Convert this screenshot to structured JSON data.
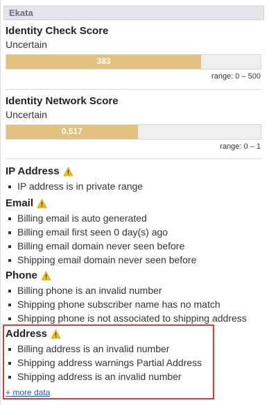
{
  "header": {
    "title": "Ekata"
  },
  "identity_check": {
    "title": "Identity Check Score",
    "status": "Uncertain",
    "value_label": "383",
    "value": 383,
    "range_label": "range: 0 – 500",
    "range_min": 0,
    "range_max": 500
  },
  "identity_network": {
    "title": "Identity Network Score",
    "status": "Uncertain",
    "value_label": "0.517",
    "value": 0.517,
    "range_label": "range: 0 – 1",
    "range_min": 0,
    "range_max": 1
  },
  "ip_address": {
    "title": "IP Address",
    "icon": "warning-icon",
    "items": [
      "IP address is in private range"
    ]
  },
  "email": {
    "title": "Email",
    "icon": "warning-icon",
    "items": [
      "Billing email is auto generated",
      "Billing email first seen 0 day(s) ago",
      "Billing email domain never seen before",
      "Shipping email domain never seen before"
    ]
  },
  "phone": {
    "title": "Phone",
    "icon": "warning-icon",
    "items": [
      "Billing phone is an invalid number",
      "Shipping phone subscriber name has no match",
      "Shipping phone is not associated to shipping address"
    ]
  },
  "address": {
    "title": "Address",
    "icon": "warning-icon",
    "items": [
      "Billing address is an invalid number",
      "Shipping address warnings Partial Address",
      "Shipping address is an invalid number"
    ],
    "more_link": "+ more data"
  },
  "colors": {
    "bar_fill": "#e3c27d",
    "bar_track": "#efefef",
    "warning": "#f2c200",
    "highlight": "#e0393d",
    "link": "#2255bb"
  }
}
